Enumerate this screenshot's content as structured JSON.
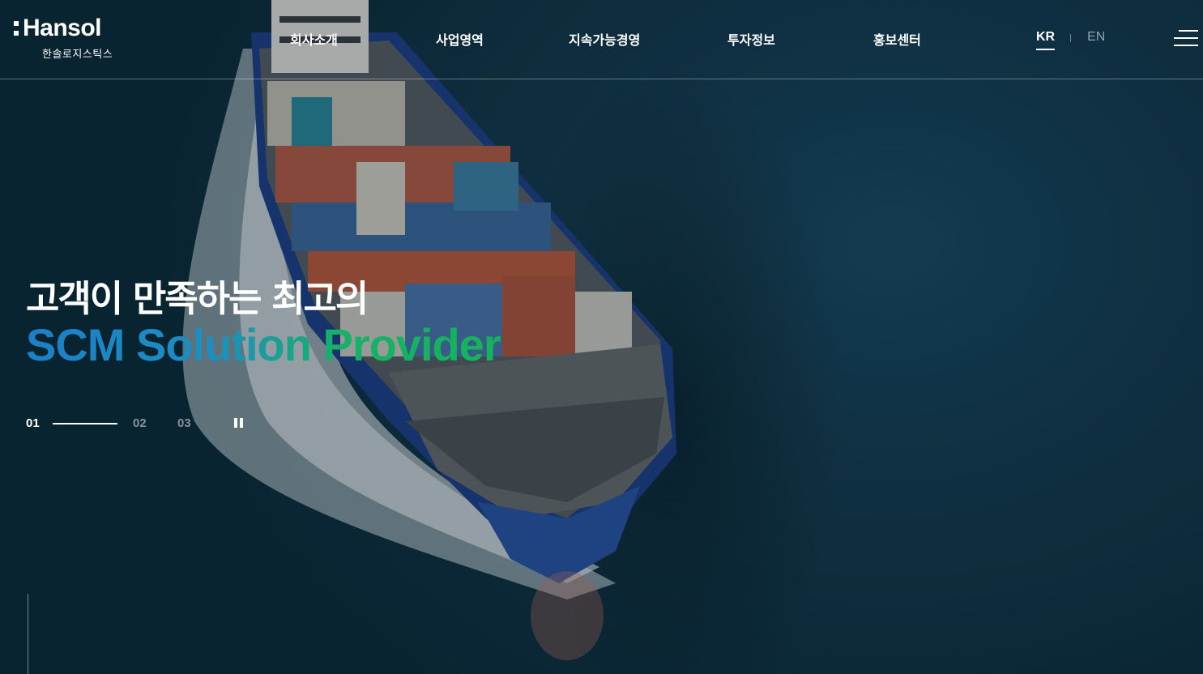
{
  "brand": {
    "name": "Hansol",
    "subtitle": "한솔로지스틱스"
  },
  "nav": {
    "items": [
      {
        "label": "회사소개"
      },
      {
        "label": "사업영역"
      },
      {
        "label": "지속가능경영"
      },
      {
        "label": "투자정보"
      },
      {
        "label": "홍보센터"
      }
    ]
  },
  "lang": {
    "kr": "KR",
    "en": "EN",
    "active": "KR"
  },
  "hero": {
    "headline": "고객이 만족하는 최고의",
    "tagline": "SCM Solution Provider",
    "tagline_colors": [
      "#1d7fc6",
      "#13b45c"
    ]
  },
  "slider": {
    "slides": [
      "01",
      "02",
      "03"
    ],
    "active_index": 0,
    "progress_fraction": 1.0
  },
  "icons": {
    "menu": "hamburger-menu-icon",
    "pause": "pause-icon"
  }
}
